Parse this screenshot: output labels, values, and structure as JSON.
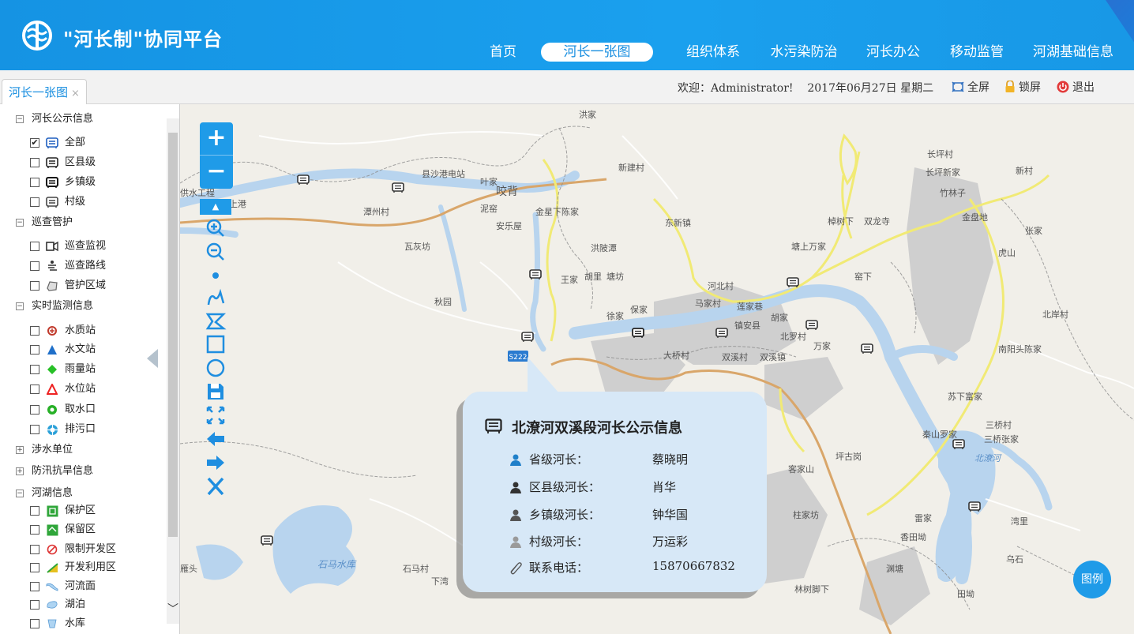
{
  "app": {
    "title": "\"河长制\"协同平台"
  },
  "nav": [
    {
      "label": "首页",
      "active": false
    },
    {
      "label": "河长一张图",
      "active": true
    },
    {
      "label": "组织体系",
      "active": false
    },
    {
      "label": "水污染防治",
      "active": false
    },
    {
      "label": "河长办公",
      "active": false
    },
    {
      "label": "移动监管",
      "active": false
    },
    {
      "label": "河湖基础信息",
      "active": false
    }
  ],
  "tab": {
    "label": "河长一张图",
    "close": "×"
  },
  "status": {
    "welcome": "欢迎：Administrator!",
    "date": "2017年06月27日 星期二",
    "fullscreen": "全屏",
    "lock": "锁屏",
    "logout": "退出"
  },
  "sidebar": {
    "groups": [
      {
        "label": "河长公示信息",
        "expanded": true,
        "items": [
          {
            "label": "全部",
            "checked": true,
            "icon": "board-icon"
          },
          {
            "label": "区县级",
            "checked": false,
            "icon": "board-icon"
          },
          {
            "label": "乡镇级",
            "checked": false,
            "icon": "board-icon"
          },
          {
            "label": "村级",
            "checked": false,
            "icon": "board-icon"
          }
        ]
      },
      {
        "label": "巡查管护",
        "expanded": true,
        "items": [
          {
            "label": "巡查监视",
            "checked": false,
            "icon": "camera-icon"
          },
          {
            "label": "巡查路线",
            "checked": false,
            "icon": "route-icon"
          },
          {
            "label": "管护区域",
            "checked": false,
            "icon": "area-icon"
          }
        ]
      },
      {
        "label": "实时监测信息",
        "expanded": true,
        "items": [
          {
            "label": "水质站",
            "checked": false,
            "icon": "water-quality-icon"
          },
          {
            "label": "水文站",
            "checked": false,
            "icon": "hydrology-icon"
          },
          {
            "label": "雨量站",
            "checked": false,
            "icon": "rain-icon"
          },
          {
            "label": "水位站",
            "checked": false,
            "icon": "water-level-icon"
          },
          {
            "label": "取水口",
            "checked": false,
            "icon": "intake-icon"
          },
          {
            "label": "排污口",
            "checked": false,
            "icon": "outfall-icon"
          }
        ]
      },
      {
        "label": "涉水单位",
        "expanded": false,
        "items": []
      },
      {
        "label": "防汛抗旱信息",
        "expanded": false,
        "items": []
      },
      {
        "label": "河湖信息",
        "expanded": true,
        "items": [
          {
            "label": "保护区",
            "checked": false,
            "icon": "protect-icon"
          },
          {
            "label": "保留区",
            "checked": false,
            "icon": "reserve-icon"
          },
          {
            "label": "限制开发区",
            "checked": false,
            "icon": "restrict-icon"
          },
          {
            "label": "开发利用区",
            "checked": false,
            "icon": "develop-icon"
          },
          {
            "label": "河流面",
            "checked": false,
            "icon": "river-icon"
          },
          {
            "label": "湖泊",
            "checked": false,
            "icon": "lake-icon"
          },
          {
            "label": "水库",
            "checked": false,
            "icon": "reservoir-icon"
          }
        ]
      }
    ]
  },
  "map": {
    "labels": [
      "洪家",
      "长坪村",
      "长坪新家",
      "竹林子",
      "新村",
      "县沙港电站",
      "叶家",
      "咬背",
      "新建村",
      "供水工程",
      "上港",
      "潭州村",
      "安乐屋",
      "泥窑",
      "金星下陈家",
      "瓦灰坊",
      "东新镇",
      "棹树下",
      "双龙寺",
      "塘上万家",
      "金盘地",
      "张家",
      "虎山",
      "王家",
      "胡里",
      "塘坊",
      "洪陂潭",
      "秋园",
      "河北村",
      "马家村",
      "莲家巷",
      "徐家",
      "保家",
      "大桥村",
      "镇安县",
      "北罗村",
      "胡家",
      "窑下",
      "万家",
      "双溪村",
      "双溪镇",
      "南阳头陈家",
      "北岸村",
      "苏下富家",
      "三桥村",
      "三桥张家",
      "北潦河",
      "秦山罗家",
      "坪古岗",
      "客家山",
      "柱家坊",
      "雷家",
      "香田坳",
      "湾里",
      "乌石",
      "田坳",
      "渊塘",
      "石马水库",
      "石马村",
      "雁头",
      "下湾",
      "林树脚下",
      "S222"
    ],
    "zoom_in": "+",
    "zoom_out": "−",
    "legend": "图例"
  },
  "popup": {
    "title": "北潦河双溪段河长公示信息",
    "rows": [
      {
        "label": "省级河长：",
        "value": "蔡晓明",
        "icon_color": "#1f7fc9"
      },
      {
        "label": "区县级河长：",
        "value": "肖华",
        "icon_color": "#333333"
      },
      {
        "label": "乡镇级河长：",
        "value": "钟华国",
        "icon_color": "#555555"
      },
      {
        "label": "村级河长：",
        "value": "万运彩",
        "icon_color": "#9a9a9a"
      },
      {
        "label": "联系电话：",
        "value": "15870667832",
        "icon_color": "#555555"
      }
    ]
  },
  "colors": {
    "brand": "#1a9cec",
    "accent": "#1f9be8",
    "popup_bg": "#d7e8f7",
    "river": "#b8d4ee",
    "urban": "#c8c8c8",
    "major_road": "#d9a66a",
    "road": "#f1ea75"
  }
}
